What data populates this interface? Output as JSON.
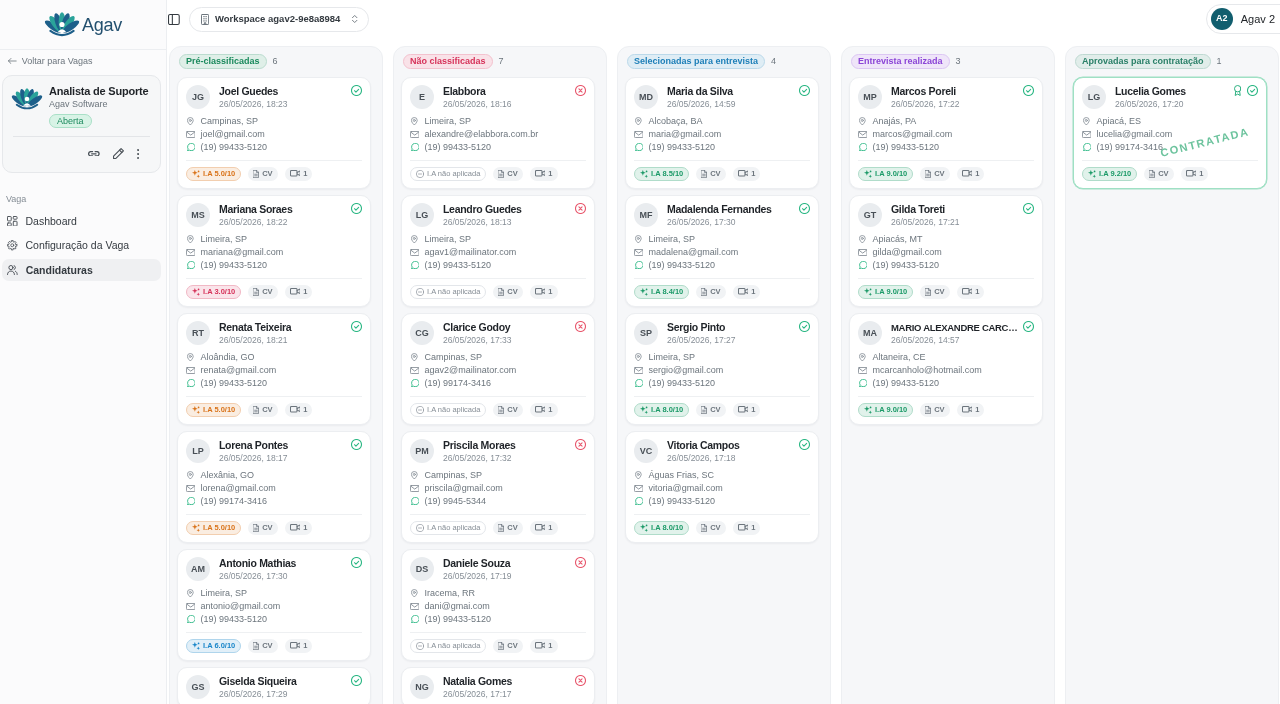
{
  "brand": {
    "name": "Agav"
  },
  "sidebar": {
    "back_link": "Voltar para Vagas",
    "job": {
      "title": "Analista de Suporte",
      "company": "Agav Software",
      "status": "Aberta"
    },
    "section": "Vaga",
    "items": [
      {
        "label": "Dashboard",
        "selected": false
      },
      {
        "label": "Configuração da Vaga",
        "selected": false
      },
      {
        "label": "Candidaturas",
        "selected": true
      }
    ]
  },
  "topbar": {
    "workspace": "Workspace agav2-9e8a8984",
    "user": {
      "initials": "A2",
      "name": "Agav 2"
    }
  },
  "columns": [
    {
      "title": "Pré-classificadas",
      "count": "6",
      "color": "#1c8a5e",
      "cards": [
        {
          "initials": "JG",
          "name": "Joel Guedes",
          "date": "26/05/2026, 18:23",
          "approved": true,
          "hired": false,
          "location": "Campinas, SP",
          "email": "joel@gmail.com",
          "phone": "(19) 99433-5120",
          "ai": {
            "kind": "score",
            "label": "I.A 5.0/10",
            "color": "#d9731a"
          },
          "cv": "CV",
          "videos": "1"
        },
        {
          "initials": "MS",
          "name": "Mariana Soraes",
          "date": "26/05/2026, 18:22",
          "approved": true,
          "hired": false,
          "location": "Limeira, SP",
          "email": "mariana@gmail.com",
          "phone": "(19) 99433-5120",
          "ai": {
            "kind": "score",
            "label": "I.A 3.0/10",
            "color": "#d6335a"
          },
          "cv": "CV",
          "videos": "1"
        },
        {
          "initials": "RT",
          "name": "Renata Teixeira",
          "date": "26/05/2026, 18:21",
          "approved": true,
          "hired": false,
          "location": "Aloândia, GO",
          "email": "renata@gmail.com",
          "phone": "(19) 99433-5120",
          "ai": {
            "kind": "score",
            "label": "I.A 5.0/10",
            "color": "#d9731a"
          },
          "cv": "CV",
          "videos": "1"
        },
        {
          "initials": "LP",
          "name": "Lorena Pontes",
          "date": "26/05/2026, 18:17",
          "approved": true,
          "hired": false,
          "location": "Alexânia, GO",
          "email": "lorena@gmail.com",
          "phone": "(19) 99174-3416",
          "ai": {
            "kind": "score",
            "label": "I.A 5.0/10",
            "color": "#d9731a"
          },
          "cv": "CV",
          "videos": "1"
        },
        {
          "initials": "AM",
          "name": "Antonio Mathias",
          "date": "26/05/2026, 17:30",
          "approved": true,
          "hired": false,
          "location": "Limeira, SP",
          "email": "antonio@gmail.com",
          "phone": "(19) 99433-5120",
          "ai": {
            "kind": "score",
            "label": "I.A 6.0/10",
            "color": "#1a86c9"
          },
          "cv": "CV",
          "videos": "1"
        },
        {
          "initials": "GS",
          "name": "Giselda Siqueira",
          "date": "26/05/2026, 17:29",
          "approved": true,
          "hired": false
        }
      ]
    },
    {
      "title": "Não classificadas",
      "count": "7",
      "color": "#d6335a",
      "cards": [
        {
          "initials": "E",
          "name": "Elabbora",
          "date": "26/05/2026, 18:16",
          "approved": false,
          "hired": false,
          "location": "Limeira, SP",
          "email": "alexandre@elabbora.com.br",
          "phone": "(19) 99433-5120",
          "ai": {
            "kind": "none",
            "label": "I.A não aplicada"
          },
          "cv": "CV",
          "videos": "1"
        },
        {
          "initials": "LG",
          "name": "Leandro Guedes",
          "date": "26/05/2026, 18:13",
          "approved": false,
          "hired": false,
          "location": "Limeira, SP",
          "email": "agav1@mailinator.com",
          "phone": "(19) 99433-5120",
          "ai": {
            "kind": "none",
            "label": "I.A não aplicada"
          },
          "cv": "CV",
          "videos": "1"
        },
        {
          "initials": "CG",
          "name": "Clarice Godoy",
          "date": "26/05/2026, 17:33",
          "approved": false,
          "hired": false,
          "location": "Campinas, SP",
          "email": "agav2@mailinator.com",
          "phone": "(19) 99174-3416",
          "ai": {
            "kind": "none",
            "label": "I.A não aplicada"
          },
          "cv": "CV",
          "videos": "1"
        },
        {
          "initials": "PM",
          "name": "Priscila Moraes",
          "date": "26/05/2026, 17:32",
          "approved": false,
          "hired": false,
          "location": "Campinas, SP",
          "email": "priscila@gmail.com",
          "phone": "(19) 9945-5344",
          "ai": {
            "kind": "none",
            "label": "I.A não aplicada"
          },
          "cv": "CV",
          "videos": "1"
        },
        {
          "initials": "DS",
          "name": "Daniele Souza",
          "date": "26/05/2026, 17:19",
          "approved": false,
          "hired": false,
          "location": "Iracema, RR",
          "email": "dani@gmai.com",
          "phone": "(19) 99433-5120",
          "ai": {
            "kind": "none",
            "label": "I.A não aplicada"
          },
          "cv": "CV",
          "videos": "1"
        },
        {
          "initials": "NG",
          "name": "Natalia Gomes",
          "date": "26/05/2026, 17:17",
          "approved": false,
          "hired": false
        }
      ]
    },
    {
      "title": "Selecionadas para entrevista",
      "count": "4",
      "color": "#1d7fb8",
      "cards": [
        {
          "initials": "MD",
          "name": "Maria da Silva",
          "date": "26/05/2026, 14:59",
          "approved": true,
          "hired": false,
          "location": "Alcobaça, BA",
          "email": "maria@gmail.com",
          "phone": "(19) 99433-5120",
          "ai": {
            "kind": "score",
            "label": "I.A 8.5/10",
            "color": "#1c9a68"
          },
          "cv": "CV",
          "videos": "1"
        },
        {
          "initials": "MF",
          "name": "Madalenda Fernandes",
          "date": "26/05/2026, 17:30",
          "approved": true,
          "hired": false,
          "location": "Limeira, SP",
          "email": "madalena@gmail.com",
          "phone": "(19) 99433-5120",
          "ai": {
            "kind": "score",
            "label": "I.A 8.4/10",
            "color": "#1c9a68"
          },
          "cv": "CV",
          "videos": "1"
        },
        {
          "initials": "SP",
          "name": "Sergio Pinto",
          "date": "26/05/2026, 17:27",
          "approved": true,
          "hired": false,
          "location": "Limeira, SP",
          "email": "sergio@gmail.com",
          "phone": "(19) 99433-5120",
          "ai": {
            "kind": "score",
            "label": "I.A 8.0/10",
            "color": "#1c9a68"
          },
          "cv": "CV",
          "videos": "1"
        },
        {
          "initials": "VC",
          "name": "Vitoria Campos",
          "date": "26/05/2026, 17:18",
          "approved": true,
          "hired": false,
          "location": "Águas Frias, SC",
          "email": "vitoria@gmail.com",
          "phone": "(19) 99433-5120",
          "ai": {
            "kind": "score",
            "label": "I.A 8.0/10",
            "color": "#1c9a68"
          },
          "cv": "CV",
          "videos": "1"
        }
      ]
    },
    {
      "title": "Entrevista realizada",
      "count": "3",
      "color": "#8b45d6",
      "cards": [
        {
          "initials": "MP",
          "name": "Marcos Poreli",
          "date": "26/05/2026, 17:22",
          "approved": true,
          "hired": false,
          "location": "Anajás, PA",
          "email": "marcos@gmail.com",
          "phone": "(19) 99433-5120",
          "ai": {
            "kind": "score",
            "label": "I.A 9.0/10",
            "color": "#1c9a68"
          },
          "cv": "CV",
          "videos": "1"
        },
        {
          "initials": "GT",
          "name": "Gilda Toreti",
          "date": "26/05/2026, 17:21",
          "approved": true,
          "hired": false,
          "location": "Apiacás, MT",
          "email": "gilda@gmail.com",
          "phone": "(19) 99433-5120",
          "ai": {
            "kind": "score",
            "label": "I.A 9.0/10",
            "color": "#1c9a68"
          },
          "cv": "CV",
          "videos": "1"
        },
        {
          "initials": "MA",
          "name": "MARIO ALEXANDRE CARC…",
          "date": "26/05/2026, 14:57",
          "approved": true,
          "hired": false,
          "location": "Altaneira, CE",
          "email": "mcarcanholo@hotmail.com",
          "phone": "(19) 99433-5120",
          "ai": {
            "kind": "score",
            "label": "I.A 9.0/10",
            "color": "#1c9a68"
          },
          "cv": "CV",
          "videos": "1"
        }
      ]
    },
    {
      "title": "Aprovadas para contratação",
      "count": "1",
      "color": "#2a8068",
      "cards": [
        {
          "initials": "LG",
          "name": "Lucelia Gomes",
          "date": "26/05/2026, 17:20",
          "approved": true,
          "hired": true,
          "stamp": "CONTRATADA",
          "location": "Apiacá, ES",
          "email": "lucelia@gmail.com",
          "phone": "(19) 99174-3416",
          "ai": {
            "kind": "score",
            "label": "I.A 9.2/10",
            "color": "#1c9a68"
          },
          "cv": "CV",
          "videos": "1"
        }
      ]
    }
  ]
}
